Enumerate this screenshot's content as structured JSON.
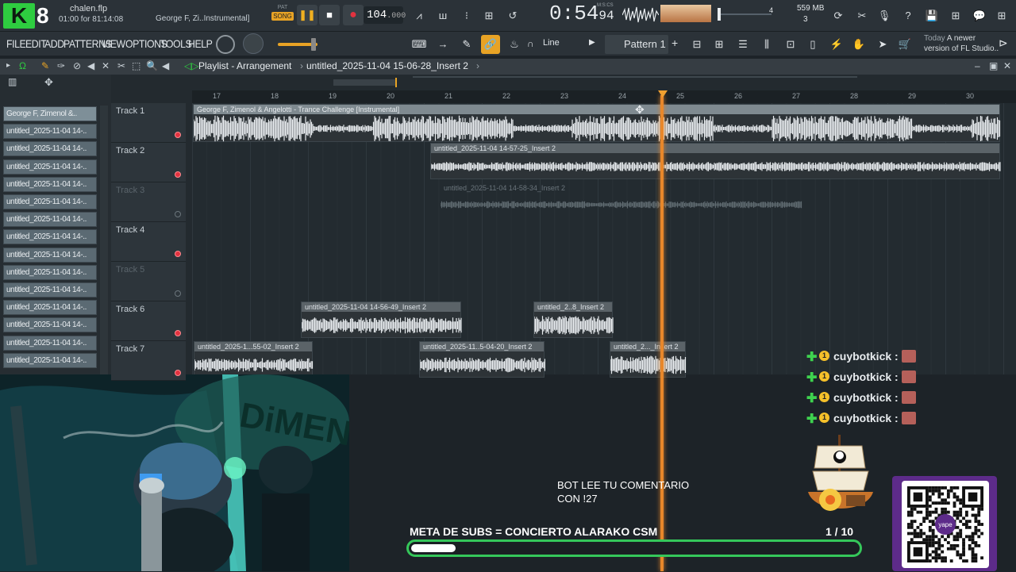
{
  "topbar": {
    "project_name": "chalen.flp",
    "time_info": "01:00 for 81:14:08",
    "hint": "George F, Zi..Instrumental]",
    "pat_label": "PAT",
    "song_label": "SONG",
    "tempo_int": "104",
    "tempo_dec": ".000",
    "clock_main": "0:54",
    "clock_sub": "94",
    "clock_unit": "M:S:CS",
    "memory": "559 MB",
    "cpu_label": "4",
    "voices": "3"
  },
  "menu": {
    "items": [
      "FILE",
      "EDIT",
      "ADD",
      "PATTERNS",
      "VIEW",
      "OPTIONS",
      "TOOLS",
      "HELP"
    ],
    "snap_label": "Line",
    "pattern": "Pattern 1",
    "news_line1": "Today",
    "news_line2": "A newer",
    "news_line3": "version of FL Studio.."
  },
  "playlist": {
    "title": "Playlist - Arrangement",
    "separator": "›",
    "file": "untitled_2025-11-04 15-06-28_Insert 2",
    "ruler": [
      "17",
      "18",
      "19",
      "20",
      "21",
      "22",
      "23",
      "24",
      "25",
      "26",
      "27",
      "28",
      "29",
      "30"
    ],
    "tracks": [
      {
        "name": "Track 1",
        "dim": false,
        "rec": true
      },
      {
        "name": "Track 2",
        "dim": false,
        "rec": true
      },
      {
        "name": "Track 3",
        "dim": true,
        "rec": false
      },
      {
        "name": "Track 4",
        "dim": false,
        "rec": true
      },
      {
        "name": "Track 5",
        "dim": true,
        "rec": false
      },
      {
        "name": "Track 6",
        "dim": false,
        "rec": true
      },
      {
        "name": "Track 7",
        "dim": false,
        "rec": true
      }
    ],
    "clips": {
      "c1": "George F, Zimenol & Angelotti - Trance Challenge [Instrumental]",
      "c2": "untitled_2025-11-04 14-57-25_Insert 2",
      "c3": "untitled_2025-11-04 14-58-34_Insert 2",
      "c4": "untitled_2025-11-04 14-56-49_Insert 2",
      "c5": "untitled_2..8_Insert 2",
      "c6": "untitled_2025-1...55-02_Insert 2",
      "c7": "untitled_2025-11..5-04-20_Insert 2",
      "c8": "untitled_2..._Insert 2"
    }
  },
  "browser": {
    "items": [
      "George F, Zimenol &..",
      "untitled_2025-11-04 14-..",
      "untitled_2025-11-04 14-..",
      "untitled_2025-11-04 14-..",
      "untitled_2025-11-04 14-..",
      "untitled_2025-11-04 14-..",
      "untitled_2025-11-04 14-..",
      "untitled_2025-11-04 14-..",
      "untitled_2025-11-04 14-..",
      "untitled_2025-11-04 14-..",
      "untitled_2025-11-04 14-..",
      "untitled_2025-11-04 14-..",
      "untitled_2025-11-04 14-..",
      "untitled_2025-11-04 14-..",
      "untitled_2025-11-04 14-.."
    ]
  },
  "overlay": {
    "chat_user": "cuybotkick :",
    "chat_coin": "1",
    "bot_line1": "BOT LEE TU COMENTARIO",
    "bot_line2": "CON !27",
    "meta_label": "META DE SUBS = CONCIERTO ALARAKO CSM",
    "meta_count": "1  / 10",
    "meta_progress": 0.1,
    "accent": "#35c75a",
    "qr_bg": "#5d2b8a",
    "qr_label": "yape"
  },
  "colors": {
    "playhead": "#e8872a",
    "record": "#e2323f",
    "snap_active": "#e8a325"
  }
}
